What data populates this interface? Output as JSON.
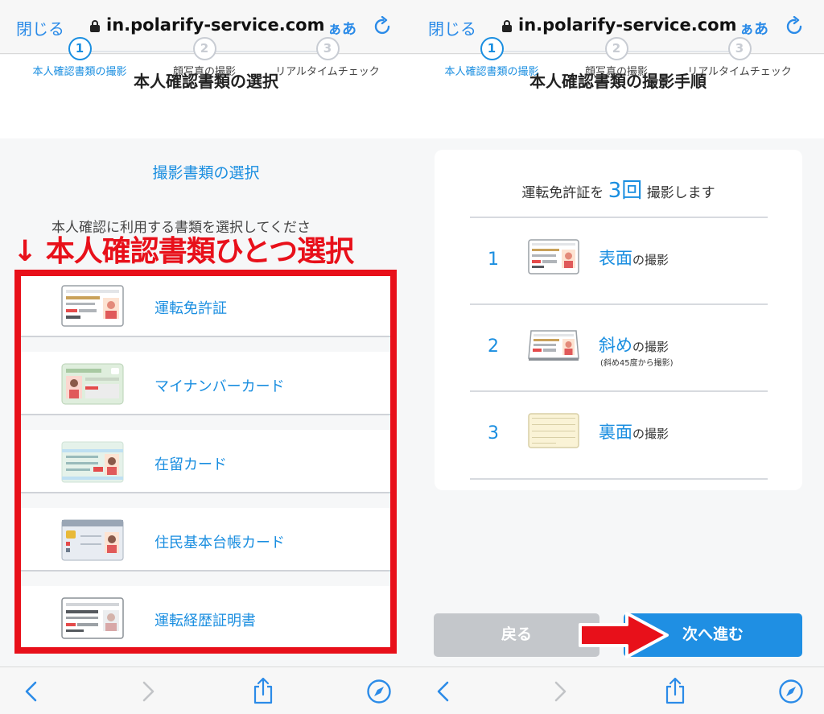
{
  "left": {
    "browser": {
      "close_label": "閉じる",
      "url": "in.polarify-service.com",
      "aa_label": "ぁあ"
    },
    "header": {
      "title": "本人確認書類の選択"
    },
    "steps": [
      {
        "number": "1",
        "label": "本人確認書類の撮影"
      },
      {
        "number": "2",
        "label": "顔写真の撮影"
      },
      {
        "number": "3",
        "label": "リアルタイムチェック"
      }
    ],
    "section": {
      "title": "撮影書類の選択",
      "subtitle": "本人確認に利用する書類を選択してくださ"
    },
    "annotation": {
      "text": "↓ 本人確認書類ひとつ選択"
    },
    "documents": [
      {
        "label": "運転免許証"
      },
      {
        "label": "マイナンバーカード"
      },
      {
        "label": "在留カード"
      },
      {
        "label": "住民基本台帳カード"
      },
      {
        "label": "運転経歴証明書"
      }
    ]
  },
  "right": {
    "browser": {
      "close_label": "閉じる",
      "url": "in.polarify-service.com",
      "aa_label": "ぁあ"
    },
    "header": {
      "title": "本人確認書類の撮影手順"
    },
    "steps": [
      {
        "number": "1",
        "label": "本人確認書類の撮影"
      },
      {
        "number": "2",
        "label": "顔写真の撮影"
      },
      {
        "number": "3",
        "label": "リアルタイムチェック"
      }
    ],
    "intro": {
      "before": "運転免許証を",
      "count": "3",
      "unit": "回",
      "after": "撮影します"
    },
    "shots": [
      {
        "number": "1",
        "title": "表面",
        "suffix": "の撮影",
        "note": ""
      },
      {
        "number": "2",
        "title": "斜め",
        "suffix": "の撮影",
        "note": "(斜め45度から撮影)"
      },
      {
        "number": "3",
        "title": "裏面",
        "suffix": "の撮影",
        "note": ""
      }
    ],
    "buttons": {
      "back": "戻る",
      "next": "次へ進む"
    }
  }
}
